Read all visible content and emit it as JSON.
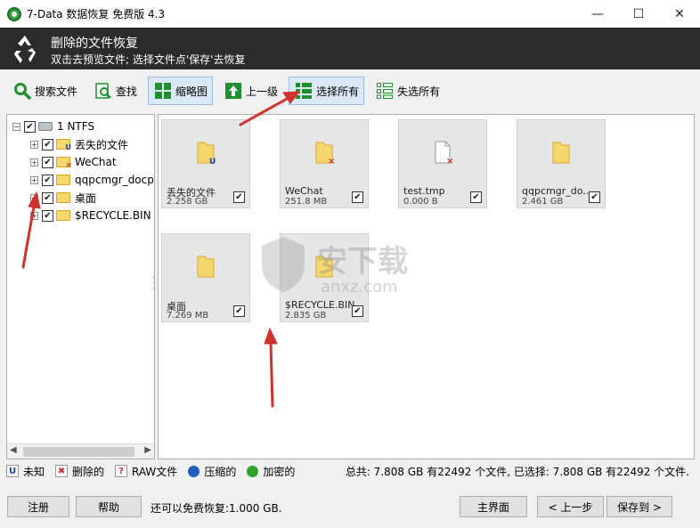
{
  "window": {
    "title": "7-Data 数据恢复 免费版 4.3",
    "minimize": "—",
    "maximize": "☐",
    "close": "✕"
  },
  "header": {
    "title": "删除的文件恢复",
    "subtitle": "双击去预览文件; 选择文件点'保存'去恢复"
  },
  "toolbar": {
    "search_files": "搜索文件",
    "find": "查找",
    "thumbnails": "缩略图",
    "up_level": "上一级",
    "select_all": "选择所有",
    "deselect_all": "失选所有"
  },
  "tree": {
    "root": "1 NTFS",
    "items": [
      {
        "label": "丢失的文件",
        "icon": "lost-folder-icon"
      },
      {
        "label": "WeChat",
        "icon": "deleted-folder-icon"
      },
      {
        "label": "qqpcmgr_docp",
        "icon": "folder-icon"
      },
      {
        "label": "桌面",
        "icon": "folder-icon"
      },
      {
        "label": "$RECYCLE.BIN",
        "icon": "folder-icon"
      }
    ]
  },
  "files": [
    {
      "name": "丢失的文件",
      "size": "2.258 GB",
      "type": "lost-folder"
    },
    {
      "name": "WeChat",
      "size": "251.8 MB",
      "type": "deleted-folder"
    },
    {
      "name": "test.tmp",
      "size": "0.000 B",
      "type": "deleted-file"
    },
    {
      "name": "qqpcmgr_do...",
      "size": "2.461 GB",
      "type": "folder"
    },
    {
      "name": "桌面",
      "size": "7.269 MB",
      "type": "folder"
    },
    {
      "name": "$RECYCLE.BIN",
      "size": "2.835 GB",
      "type": "folder"
    }
  ],
  "legend": {
    "unknown": "未知",
    "deleted": "删除的",
    "raw": "RAW文件",
    "compressed": "压缩的",
    "encrypted": "加密的",
    "summary": "总共: 7.808 GB 有22492 个文件, 已选择: 7.808 GB 有22492 个文件."
  },
  "bottom": {
    "register": "注册",
    "help": "帮助",
    "free_quota": "还可以免费恢复:1.000 GB.",
    "main_menu": "主界面",
    "back": "< 上一步",
    "save_to": "保存到 >"
  },
  "watermark": {
    "text": "安下载",
    "domain": "anxz.com"
  },
  "colors": {
    "header_bg": "#2b2b2b",
    "accent_green": "#2e9e3a",
    "arrow_red": "#d0312d",
    "folder_yellow": "#f5d76e"
  }
}
